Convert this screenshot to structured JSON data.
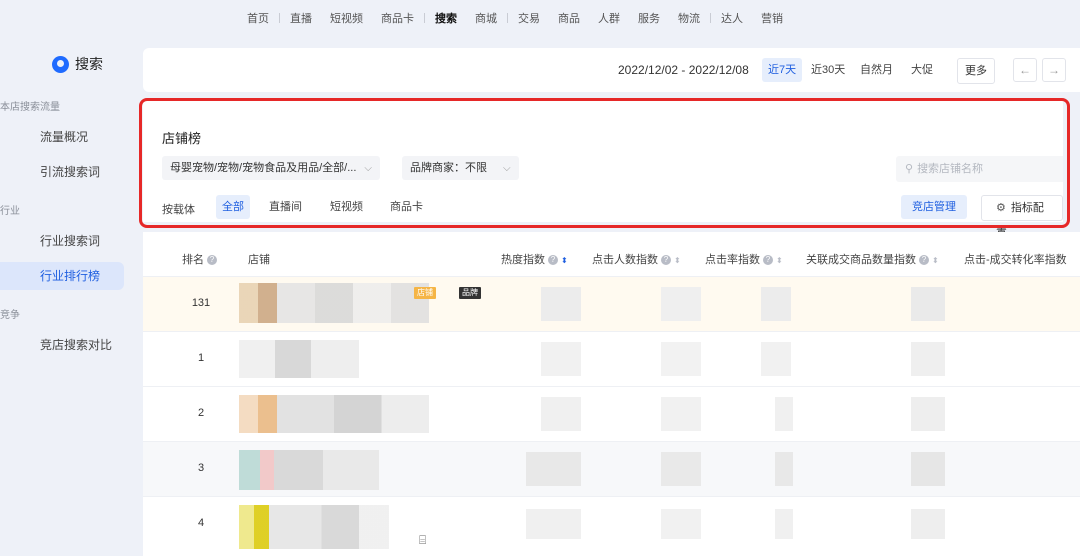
{
  "topnav": {
    "items": [
      {
        "label": "首页"
      },
      {
        "label": "直播"
      },
      {
        "label": "短视频"
      },
      {
        "label": "商品卡"
      },
      {
        "label": "搜索"
      },
      {
        "label": "商城"
      },
      {
        "label": "交易"
      },
      {
        "label": "商品"
      },
      {
        "label": "人群"
      },
      {
        "label": "服务"
      },
      {
        "label": "物流"
      },
      {
        "label": "达人"
      },
      {
        "label": "营销"
      }
    ],
    "active": "搜索"
  },
  "sidebar": {
    "brand": "搜索",
    "groups": [
      {
        "title": "本店搜索流量",
        "items": [
          {
            "label": "流量概况"
          },
          {
            "label": "引流搜索词"
          }
        ]
      },
      {
        "title": "行业",
        "items": [
          {
            "label": "行业搜索词"
          },
          {
            "label": "行业排行榜"
          }
        ]
      },
      {
        "title": "竞争",
        "items": [
          {
            "label": "竞店搜索对比"
          }
        ]
      }
    ],
    "active": "行业排行榜"
  },
  "datebar": {
    "range": "2022/12/02 - 2022/12/08",
    "quick": [
      {
        "label": "近7天"
      },
      {
        "label": "近30天"
      },
      {
        "label": "自然月"
      },
      {
        "label": "大促"
      }
    ],
    "active": "近7天",
    "more": "更多",
    "prev": "←",
    "next": "→"
  },
  "filter": {
    "title": "店铺榜",
    "category": "母婴宠物/宠物/宠物食品及用品/全部/...",
    "brand_merchant": "品牌商家：不限",
    "search_placeholder": "搜索店铺名称",
    "carrier_label": "按载体",
    "tabs": [
      {
        "label": "全部"
      },
      {
        "label": "直播间"
      },
      {
        "label": "短视频"
      },
      {
        "label": "商品卡"
      }
    ],
    "active_tab": "全部",
    "compete_button": "竞店管理",
    "config_button": "指标配置"
  },
  "table": {
    "columns": [
      {
        "label": "排名"
      },
      {
        "label": "店铺"
      },
      {
        "label": "热度指数"
      },
      {
        "label": "点击人数指数"
      },
      {
        "label": "点击率指数"
      },
      {
        "label": "关联成交商品数量指数"
      },
      {
        "label": "点击-成交转化率指数"
      }
    ],
    "rows": [
      {
        "rank": "131",
        "tag_shop": "店铺",
        "tag_brand": "品牌"
      },
      {
        "rank": "1"
      },
      {
        "rank": "2"
      },
      {
        "rank": "3"
      },
      {
        "rank": "4"
      }
    ]
  },
  "colors": {
    "accent": "#1f5fe0",
    "highlight": "#e62828",
    "shop_badge": "#f5b546"
  }
}
